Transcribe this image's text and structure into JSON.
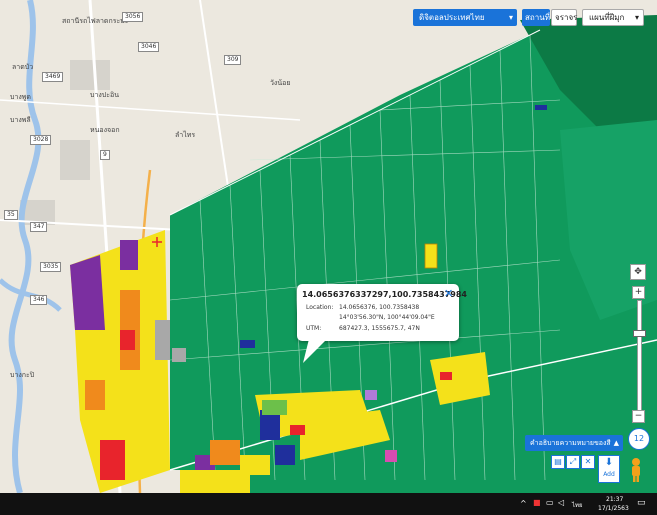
{
  "top_controls": {
    "province_select": "ดิจิตอลประเทศไทย",
    "station_label": "สถานที่",
    "traffic_label": "จราจร",
    "map_type_select": "แผนที่ฝีมุก"
  },
  "popup": {
    "title": "14.0656376337297,100.7358437984",
    "location_label": "Location:",
    "location_value": "14.0656376, 100.7358438",
    "dms_value": "14°03'56.30\"N, 100°44'09.04\"E",
    "utm_label": "UTM:",
    "utm_value": "687427.3, 1555675.7, 47N"
  },
  "zoom": {
    "plus": "+",
    "minus": "−",
    "level": "12"
  },
  "legend_button": "คำอธิบายความหมายของสี",
  "legend_chevron": "▲",
  "tool_icons": [
    "layers-icon",
    "measure-icon",
    "close-icon"
  ],
  "add_label": "Add",
  "taskbar": {
    "time": "21:37",
    "date": "17/1/2563",
    "lang": "ไทย"
  },
  "map_labels": [
    {
      "text": "สถานีรถไฟลาดกระบัง"
    },
    {
      "text": "ลาดบัว"
    },
    {
      "text": "บางพูด"
    },
    {
      "text": "บางปะอิน"
    },
    {
      "text": "บางพลี"
    },
    {
      "text": "วังน้อย"
    },
    {
      "text": "ลำไทร"
    },
    {
      "text": "หนองจอก"
    },
    {
      "text": "บางกะปิ"
    }
  ],
  "road_shields": [
    "3056",
    "3469",
    "347",
    "309",
    "3046",
    "346",
    "35",
    "9",
    "3028",
    "3035"
  ],
  "colors": {
    "green_zone": "#109a5c",
    "dark_green": "#0c7a45",
    "yellow_zone": "#f4e11a",
    "purple_zone": "#7b2fa0",
    "orange_zone": "#f08a1c",
    "red_zone": "#e8242c",
    "blue_zone": "#1f2f9c",
    "ui_blue": "#1a73d9"
  }
}
